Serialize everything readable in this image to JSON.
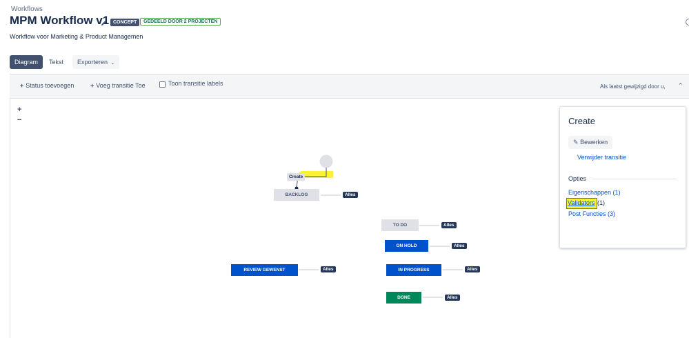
{
  "header": {
    "breadcrumb": "Workflows",
    "title": "MPM Workflow v1",
    "badge_concept": "CONCEPT",
    "badge_shared": "GEDEELD DOOR 2 PROJECTEN",
    "description": "Workflow voor Marketing & Product Managemen"
  },
  "tabs": {
    "diagram": "Diagram",
    "text": "Tekst",
    "export": "Exporteren"
  },
  "toolbar": {
    "add_status": "Status toevoegen",
    "add_transition": "Voeg transitie Toe",
    "show_labels": "Toon transitie labels",
    "last_changed": "Als laatst gewijzigd door u,"
  },
  "zoom": {
    "in": "+",
    "out": "−"
  },
  "diagram": {
    "create_label": "Create",
    "statuses": {
      "backlog": "BACKLOG",
      "todo": "TO DO",
      "onhold": "ON HOLD",
      "review": "REVIEW GEWENST",
      "inprogress": "IN PROGRESS",
      "done": "DONE"
    },
    "all_label": "Alles"
  },
  "panel": {
    "title": "Create",
    "edit_button": "Bewerken",
    "remove_link": "Verwijder transitie",
    "options_label": "Opties",
    "properties": "Eigenschappen (1)",
    "validators": "Validators",
    "validators_count": "(1)",
    "post_functions": "Post Functies (3)"
  },
  "colors": {
    "blue_status": "#0052cc",
    "green_status": "#00875a",
    "grey_status": "#dfe1e6",
    "highlight": "#fdf232",
    "link": "#0052cc"
  }
}
